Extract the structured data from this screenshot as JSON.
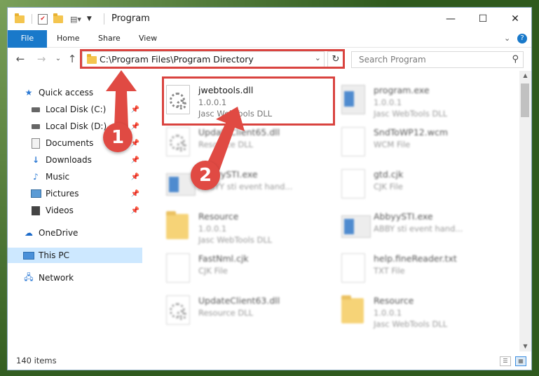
{
  "window": {
    "title": "Program",
    "controls": {
      "minimize": "—",
      "maximize": "☐",
      "close": "✕"
    }
  },
  "ribbon": {
    "tabs": [
      "File",
      "Home",
      "Share",
      "View"
    ],
    "help": "?"
  },
  "address": {
    "path": "C:\\Program Files\\Program Directory",
    "search_placeholder": "Search Program"
  },
  "sidebar": {
    "items": [
      {
        "label": "Quick access",
        "icon": "star-icon"
      },
      {
        "label": "Local Disk (C:)",
        "icon": "drive-icon"
      },
      {
        "label": "Local Disk (D:)",
        "icon": "drive-icon"
      },
      {
        "label": "Documents",
        "icon": "documents-icon"
      },
      {
        "label": "Downloads",
        "icon": "download-icon"
      },
      {
        "label": "Music",
        "icon": "music-icon"
      },
      {
        "label": "Pictures",
        "icon": "pictures-icon"
      },
      {
        "label": "Videos",
        "icon": "videos-icon"
      },
      {
        "label": "OneDrive",
        "icon": "cloud-icon"
      },
      {
        "label": "This PC",
        "icon": "computer-icon"
      },
      {
        "label": "Network",
        "icon": "network-icon"
      }
    ]
  },
  "files": [
    {
      "name": "jwebtools.dll",
      "line1": "1.0.0.1",
      "line2": "Jasc WebTools DLL",
      "kind": "dll"
    },
    {
      "name": "program.exe",
      "line1": "1.0.0.1",
      "line2": "Jasc WebTools DLL",
      "kind": "app"
    },
    {
      "name": "UpdateClient65.dll",
      "line1": "Resource DLL",
      "line2": "",
      "kind": "dll"
    },
    {
      "name": "SndToWP12.wcm",
      "line1": "WCM File",
      "line2": "",
      "kind": "doc"
    },
    {
      "name": "AbbyySTI.exe",
      "line1": "ABBYY sti event hand...",
      "line2": "",
      "kind": "app"
    },
    {
      "name": "gtd.cjk",
      "line1": "CJK File",
      "line2": "",
      "kind": "doc"
    },
    {
      "name": "Resource",
      "line1": "1.0.0.1",
      "line2": "Jasc WebTools DLL",
      "kind": "folder"
    },
    {
      "name": "AbbyySTI.exe",
      "line1": "ABBY sti event hand...",
      "line2": "",
      "kind": "app"
    },
    {
      "name": "FastNml.cjk",
      "line1": "CJK File",
      "line2": "",
      "kind": "doc"
    },
    {
      "name": "help.fineReader.txt",
      "line1": "TXT File",
      "line2": "",
      "kind": "doc"
    },
    {
      "name": "UpdateClient63.dll",
      "line1": "Resource DLL",
      "line2": "",
      "kind": "dll"
    },
    {
      "name": "Resource",
      "line1": "1.0.0.1",
      "line2": "Jasc WebTools DLL",
      "kind": "folder"
    }
  ],
  "status": {
    "count": "140 items"
  },
  "annotations": {
    "badge1": "1",
    "badge2": "2"
  },
  "colors": {
    "accent": "#1979ca",
    "highlight": "#d9433f",
    "selected": "#cde8ff"
  }
}
